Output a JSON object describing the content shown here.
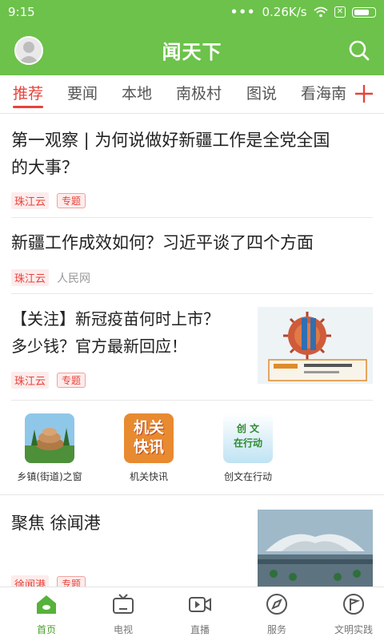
{
  "status": {
    "time": "9:15",
    "network_speed": "0.26K/s"
  },
  "header": {
    "title": "闻天下"
  },
  "tabs": [
    {
      "label": "推荐",
      "active": true
    },
    {
      "label": "要闻"
    },
    {
      "label": "本地"
    },
    {
      "label": "南极村"
    },
    {
      "label": "图说"
    },
    {
      "label": "看海南"
    }
  ],
  "articles": [
    {
      "title_line1": "第一观察 | 为何说做好新疆工作是全党全国",
      "title_line2": "的大事？",
      "source": "珠江云",
      "tag": "专题"
    },
    {
      "title": "新疆工作成效如何？习近平谈了四个方面",
      "source": "珠江云",
      "secondary": "人民网"
    },
    {
      "title_line1": "【关注】新冠疫苗何时上市？",
      "title_line2": "多少钱？官方最新回应！",
      "source": "珠江云",
      "tag": "专题"
    },
    {
      "title": "聚焦 徐闻港",
      "source": "徐闻港",
      "tag": "专题"
    }
  ],
  "shortcuts": [
    {
      "label": "乡镇(街道)之窗"
    },
    {
      "label": "机关快讯",
      "image_text_top": "机关",
      "image_text_bottom": "快讯"
    },
    {
      "label": "创文在行动",
      "image_text_top": "创 文",
      "image_text_bottom": "在行动"
    }
  ],
  "bottom_nav": [
    {
      "label": "首页",
      "icon": "home-icon",
      "active": true
    },
    {
      "label": "电视",
      "icon": "tv-icon"
    },
    {
      "label": "直播",
      "icon": "live-video-icon"
    },
    {
      "label": "服务",
      "icon": "compass-icon"
    },
    {
      "label": "文明实践",
      "icon": "flag-icon"
    }
  ],
  "colors": {
    "brand_green": "#6cc24a",
    "accent_red": "#e8423a",
    "nav_active": "#4a9e2f"
  }
}
